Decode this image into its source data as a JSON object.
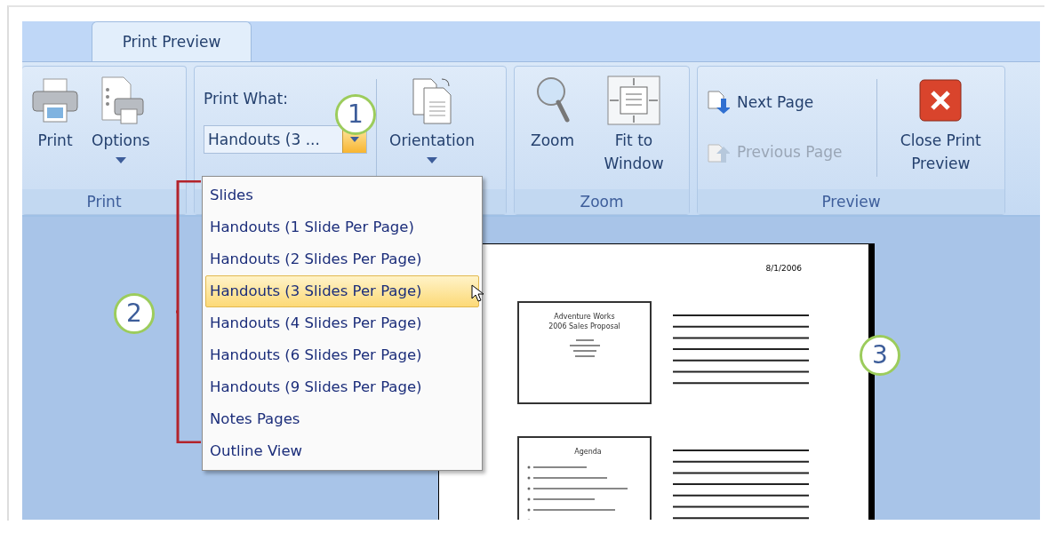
{
  "tabs": [
    {
      "label": "Print Preview",
      "selected": true
    }
  ],
  "groups": [
    {
      "label": "Print",
      "controls": [
        {
          "kind": "large",
          "label": "Print",
          "menu": false
        },
        {
          "kind": "large",
          "label": "Options",
          "menu": true
        }
      ]
    },
    {
      "controls": [
        {
          "kind": "combo",
          "label": "Print What:",
          "value": "Handouts (3 ...",
          "open": true
        },
        {
          "kind": "divider"
        },
        {
          "kind": "large",
          "label": "Orientation",
          "menu": true
        }
      ]
    },
    {
      "label": "Zoom",
      "controls": [
        {
          "kind": "large",
          "label": "Zoom",
          "menu": false
        },
        {
          "kind": "large",
          "label": "Fit to Window",
          "menu": false
        }
      ]
    },
    {
      "label": "Preview",
      "controls": [
        {
          "kind": "stack",
          "items": [
            {
              "label": "Next Page",
              "disabled": false
            },
            {
              "label": "Previous Page",
              "disabled": true
            }
          ]
        },
        {
          "kind": "divider"
        },
        {
          "kind": "large",
          "label": "Close Print Preview",
          "menu": false
        }
      ]
    }
  ],
  "dropdown": {
    "options": [
      {
        "label": "Slides",
        "selected": false
      },
      {
        "label": "Handouts (1 Slide Per Page)",
        "selected": false
      },
      {
        "label": "Handouts (2 Slides Per Page)",
        "selected": false
      },
      {
        "label": "Handouts (3 Slides Per Page)",
        "selected": true
      },
      {
        "label": "Handouts (4 Slides Per Page)",
        "selected": false
      },
      {
        "label": "Handouts (6 Slides Per Page)",
        "selected": false
      },
      {
        "label": "Handouts (9 Slides Per Page)",
        "selected": false
      },
      {
        "label": "Notes Pages",
        "selected": false
      },
      {
        "label": "Outline View",
        "selected": false
      }
    ]
  },
  "preview": {
    "date": "8/1/2006",
    "slides": [
      {
        "title": "Adventure Works 2006 Sales Proposal",
        "kind": "title"
      },
      {
        "title": "Agenda",
        "kind": "bullets"
      }
    ]
  },
  "callouts": [
    "1",
    "2",
    "3"
  ]
}
